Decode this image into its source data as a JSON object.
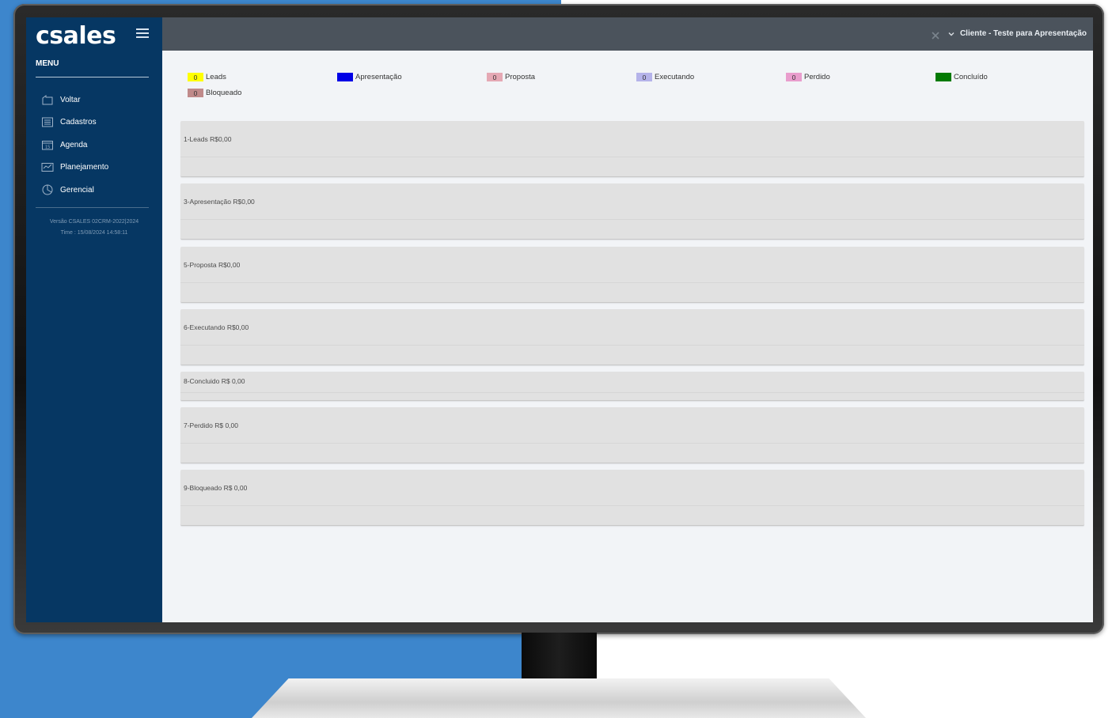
{
  "brand": {
    "logo_text": "csales"
  },
  "sidebar": {
    "menu_title": "MENU",
    "items": [
      {
        "label": "Voltar",
        "icon": "back-icon"
      },
      {
        "label": "Cadastros",
        "icon": "registry-icon"
      },
      {
        "label": "Agenda",
        "icon": "calendar-icon"
      },
      {
        "label": "Planejamento",
        "icon": "planning-icon"
      },
      {
        "label": "Gerencial",
        "icon": "pie-chart-icon"
      }
    ],
    "version_line1": "Versão CSALES 02CRM-2022|2024",
    "version_line2": "Time : 15/08/2024 14:58:11"
  },
  "topbar": {
    "client_label": "Cliente - Teste para Apresentação"
  },
  "legend": [
    {
      "count": "0",
      "label": "Leads",
      "color": "#ffff00"
    },
    {
      "count": "0",
      "label": "Apresentação",
      "color": "#0000e6"
    },
    {
      "count": "0",
      "label": "Proposta",
      "color": "#e5a8b4"
    },
    {
      "count": "0",
      "label": "Executando",
      "color": "#b5b3ea"
    },
    {
      "count": "0",
      "label": "Perdido",
      "color": "#e99dcd"
    },
    {
      "count": "0",
      "label": "Concluído",
      "color": "#047a04"
    },
    {
      "count": "0",
      "label": "Bloqueado",
      "color": "#c08a8a"
    }
  ],
  "stages": [
    {
      "title": "1-Leads R$0,00"
    },
    {
      "title": "3-Apresentação R$0,00"
    },
    {
      "title": "5-Proposta R$0,00"
    },
    {
      "title": "6-Executando R$0,00"
    },
    {
      "title": "8-Concluido R$ 0,00"
    },
    {
      "title": "7-Perdido R$ 0,00"
    },
    {
      "title": "9-Bloqueado R$ 0,00"
    }
  ]
}
